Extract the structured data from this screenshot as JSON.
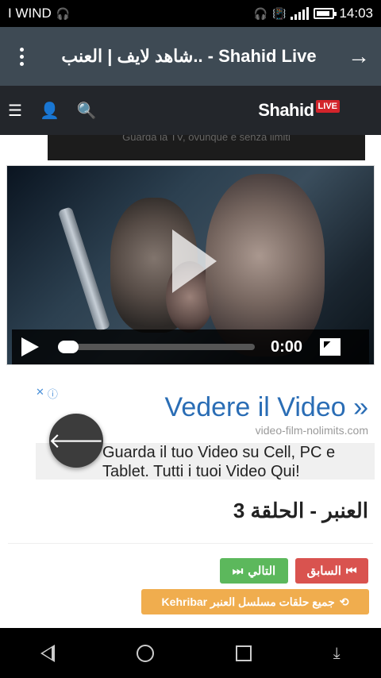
{
  "status_bar": {
    "carrier": "I WIND",
    "time": "14:03",
    "icons": [
      "headset-icon",
      "signal-icon",
      "battery-icon"
    ]
  },
  "browser": {
    "title": "شاهد لايف | العنب.. - Shahid Live"
  },
  "site": {
    "logo_text": "Shahid",
    "logo_badge": "LIVE",
    "banner_text": "Guarda la TV, ovunque e senza limiti"
  },
  "video": {
    "time": "0:00",
    "progress": 0
  },
  "ad": {
    "title": "Vedere il Video »",
    "url": "video-film-nolimits.com",
    "text": "Guarda il tuo Video su Cell, PC e Tablet. Tutti i tuoi Video Qui!"
  },
  "article": {
    "title": "العنبر - الحلقة 3",
    "prev_label": "السابق",
    "next_label": "التالي",
    "all_episodes_label": "جميع حلقات مسلسل العنبر Kehribar"
  },
  "colors": {
    "header_bg": "#23262b",
    "chrome_bg": "#3e4a54",
    "prev": "#d9534f",
    "next": "#5cb85c",
    "all": "#f0ad4e",
    "ad_title": "#2a6db5",
    "logo_badge": "#d3242b"
  }
}
